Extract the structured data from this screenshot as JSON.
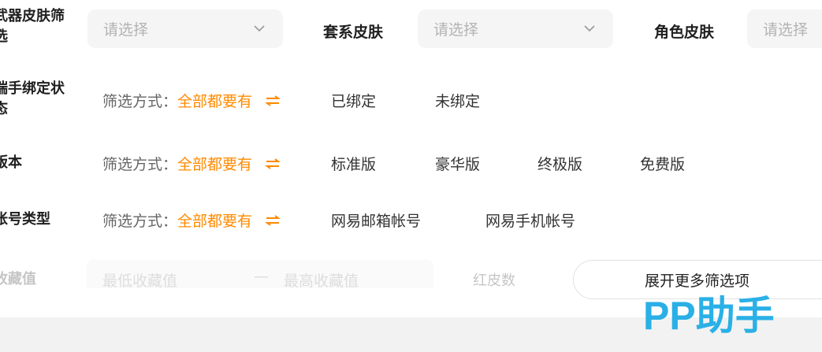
{
  "weapon_skin": {
    "label": "武器皮肤筛选",
    "placeholder": "请选择"
  },
  "suit_skin": {
    "label": "套系皮肤",
    "placeholder": "请选择"
  },
  "role_skin": {
    "label": "角色皮肤",
    "placeholder": "请选择"
  },
  "binding": {
    "label": "端手绑定状态",
    "mode_prefix": "筛选方式：",
    "mode_value": "全部都要有",
    "options": [
      "已绑定",
      "未绑定"
    ]
  },
  "version": {
    "label": "版本",
    "mode_prefix": "筛选方式：",
    "mode_value": "全部都要有",
    "options": [
      "标准版",
      "豪华版",
      "终极版",
      "免费版"
    ]
  },
  "account_type": {
    "label": "帐号类型",
    "mode_prefix": "筛选方式：",
    "mode_value": "全部都要有",
    "options": [
      "网易邮箱帐号",
      "网易手机帐号"
    ]
  },
  "collection": {
    "label": "收藏值",
    "min_placeholder": "最低收藏值",
    "separator": "—",
    "max_placeholder": "最高收藏值",
    "red_skin_label": "红皮数"
  },
  "expand_button": "展开更多筛选项",
  "watermark": "PP助手",
  "colors": {
    "accent": "#ff8a00",
    "watermark": "#2ab0e6"
  },
  "icons": {
    "dropdown": "chevron-down-icon",
    "swap": "swap-arrows-icon"
  }
}
